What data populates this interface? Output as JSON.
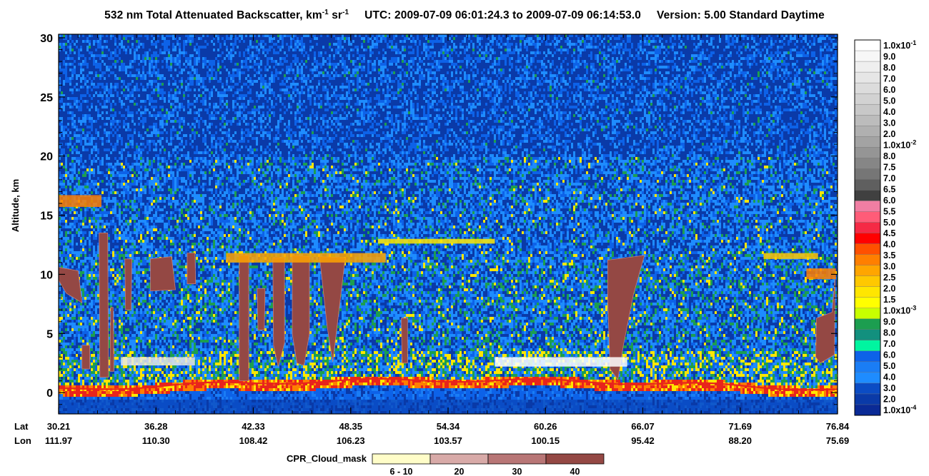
{
  "title": {
    "prefix": "532 nm Total Attenuated Backscatter, km",
    "unit_exp1": "-1",
    "unit_mid": " sr",
    "unit_exp2": "-1",
    "utc_label": "UTC:",
    "utc_start": "2009-07-09 06:01:24.3",
    "to_word": "to",
    "utc_end": "2009-07-09 06:14:53.0",
    "version": "Version: 5.00",
    "product": "Standard",
    "daynight": "Daytime"
  },
  "chart_data": {
    "type": "heatmap",
    "ylabel": "Altitude, km",
    "ylim": [
      -1.8,
      30.3
    ],
    "yticks": [
      0,
      5,
      10,
      15,
      20,
      25,
      30
    ],
    "x_row_labels": [
      "Lat",
      "Lon"
    ],
    "lat": [
      "30.21",
      "36.28",
      "42.33",
      "48.35",
      "54.34",
      "60.26",
      "66.07",
      "71.69",
      "76.84"
    ],
    "lon": [
      "111.97",
      "110.30",
      "108.42",
      "106.23",
      "103.57",
      "100.15",
      "95.42",
      "88.20",
      "75.69"
    ],
    "colorbar": {
      "labels": [
        "1.0x10-1",
        "9.0",
        "8.0",
        "7.0",
        "6.0",
        "5.0",
        "4.0",
        "3.0",
        "2.0",
        "1.0x10-2",
        "8.0",
        "7.5",
        "7.0",
        "6.5",
        "6.0",
        "5.5",
        "5.0",
        "4.5",
        "4.0",
        "3.5",
        "3.0",
        "2.5",
        "2.0",
        "1.5",
        "1.0x10-3",
        "9.0",
        "8.0",
        "7.0",
        "6.0",
        "5.0",
        "4.0",
        "3.0",
        "2.0",
        "1.0x10-4"
      ],
      "colors": [
        "#ffffff",
        "#f7f7f7",
        "#efefef",
        "#e6e6e6",
        "#dcdcdc",
        "#d2d2d2",
        "#c8c8c8",
        "#bcbcbc",
        "#b0b0b0",
        "#a3a3a3",
        "#959595",
        "#868686",
        "#767676",
        "#5f5f5f",
        "#404040",
        "#f07ea3",
        "#ff5c78",
        "#f52a45",
        "#ff0000",
        "#ff5000",
        "#ff7f00",
        "#ffa500",
        "#ffc800",
        "#ffe600",
        "#ffff00",
        "#c8ff00",
        "#1c9e50",
        "#12907e",
        "#00f5a0",
        "#0d62e8",
        "#1a7df5",
        "#1e8cff",
        "#0b4cc4",
        "#0a3aa8",
        "#0a2a96"
      ]
    },
    "cpr_legend": {
      "title": "CPR_Cloud_mask",
      "labels": [
        "6 - 10",
        "20",
        "30",
        "40"
      ],
      "colors": [
        "#fffdc8",
        "#d8aaa8",
        "#b87676",
        "#944844"
      ]
    },
    "features": {
      "surface_return_color": "#e8241c",
      "cpr_cloud_color": "#944844",
      "background_color": "#0a3aa8"
    }
  }
}
